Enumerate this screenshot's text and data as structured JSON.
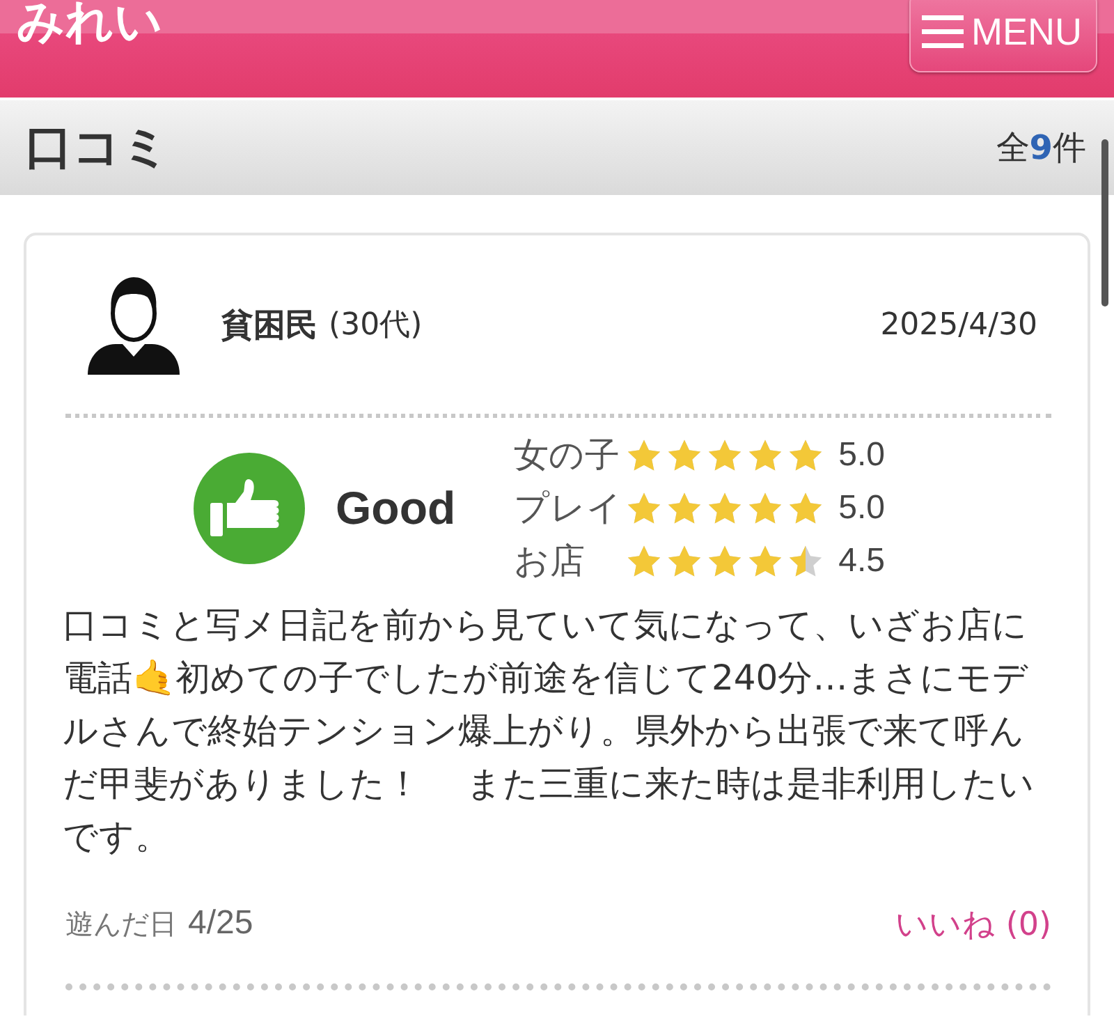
{
  "header": {
    "title": "みれい",
    "menu_button": "MENU"
  },
  "section": {
    "title": "口コミ",
    "count": "全**9**件"
  },
  "review": {
    "reviewer": "貧困民",
    "age": "(30代)",
    "date": "2025/4/30",
    "verdict": "Good",
    "ratings": [
      {
        "label": "女の子",
        "stars": 5,
        "value": "5.0"
      },
      {
        "label": "プレイ",
        "stars": 5,
        "value": "5.0"
      },
      {
        "label": "お店",
        "stars": 4.5,
        "value": "4.5"
      }
    ],
    "body": "口コミと写メ日記を前から見ていて気になって、いざお店に電話🤙初めての子でしたが前途を信じて240分…まさにモデルさんで終始テンション爆上がり。県外から出張で来て呼んだ甲斐がありました！　 また三重に来た時は是非利用したいです。",
    "visit_label": "遊んだ日",
    "visit_date": "4/25",
    "like_button": "いいね (0)"
  }
}
